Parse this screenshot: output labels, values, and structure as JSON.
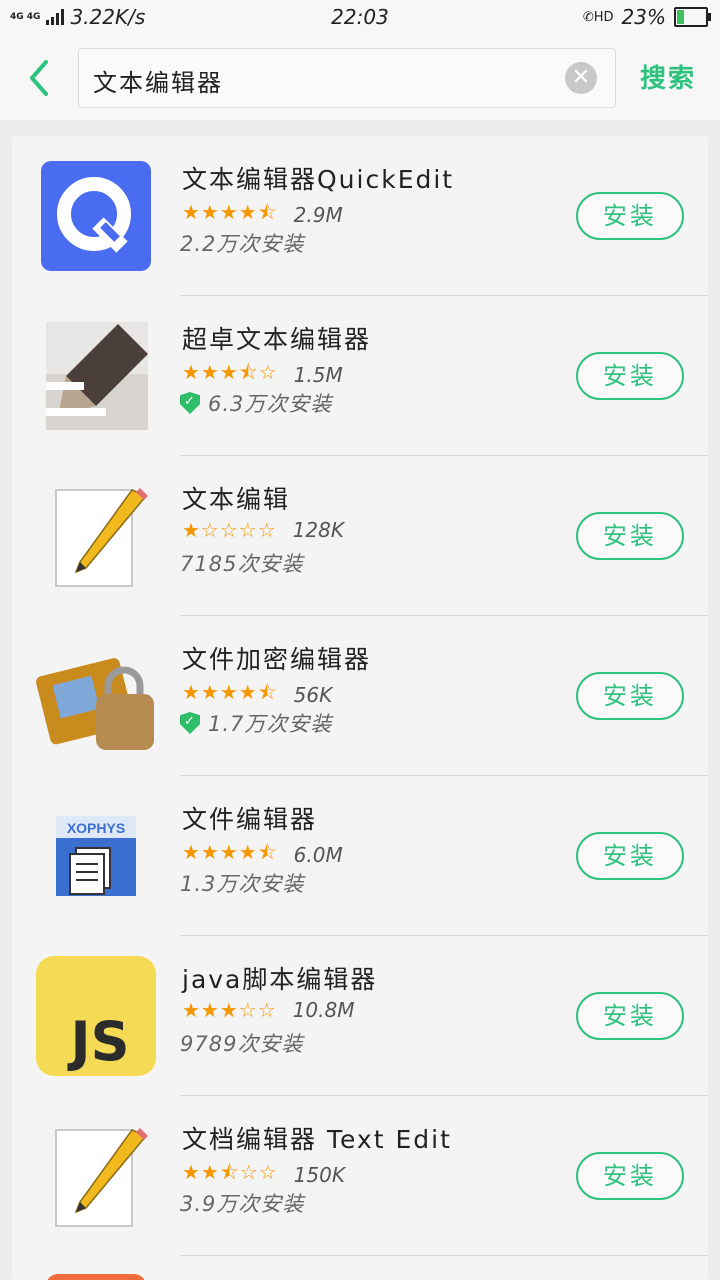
{
  "status": {
    "network": "4G 4G",
    "speed": "3.22K/s",
    "time": "22:03",
    "hd": "HD",
    "battery_percent": "23%",
    "battery_level": 0.23
  },
  "search": {
    "back_icon": "back-arrow-icon",
    "query": "文本编辑器",
    "clear_icon": "clear-icon",
    "button_label": "搜索"
  },
  "colors": {
    "accent": "#2ec27e",
    "star": "#f39800",
    "verified": "#2ebd69"
  },
  "apps": [
    {
      "name": "文本编辑器QuickEdit",
      "stars": "★★★★⯪",
      "size": "2.9M",
      "installs": "2.2万次安装",
      "verified": false,
      "install_label": "安装",
      "icon": "quickedit-icon"
    },
    {
      "name": "超卓文本编辑器",
      "stars": "★★★⯪☆",
      "size": "1.5M",
      "installs": "6.3万次安装",
      "verified": true,
      "install_label": "安装",
      "icon": "super-text-editor-icon"
    },
    {
      "name": "文本编辑",
      "stars": "★☆☆☆☆",
      "size": "128K",
      "installs": "7185次安装",
      "verified": false,
      "install_label": "安装",
      "icon": "document-pencil-icon"
    },
    {
      "name": "文件加密编辑器",
      "stars": "★★★★⯪",
      "size": "56K",
      "installs": "1.7万次安装",
      "verified": true,
      "install_label": "安装",
      "icon": "folder-lock-icon"
    },
    {
      "name": "文件编辑器",
      "stars": "★★★★⯪",
      "size": "6.0M",
      "installs": "1.3万次安装",
      "verified": false,
      "install_label": "安装",
      "icon": "xophys-icon"
    },
    {
      "name": "java脚本编辑器",
      "stars": "★★★☆☆",
      "size": "10.8M",
      "installs": "9789次安装",
      "verified": false,
      "install_label": "安装",
      "icon": "js-icon"
    },
    {
      "name": "文档编辑器 Text Edit",
      "stars": "★★⯪☆☆",
      "size": "150K",
      "installs": "3.9万次安装",
      "verified": false,
      "install_label": "安装",
      "icon": "document-pencil-icon"
    }
  ],
  "icon_labels": {
    "xophys": "XOPHYS",
    "js": "JS"
  }
}
